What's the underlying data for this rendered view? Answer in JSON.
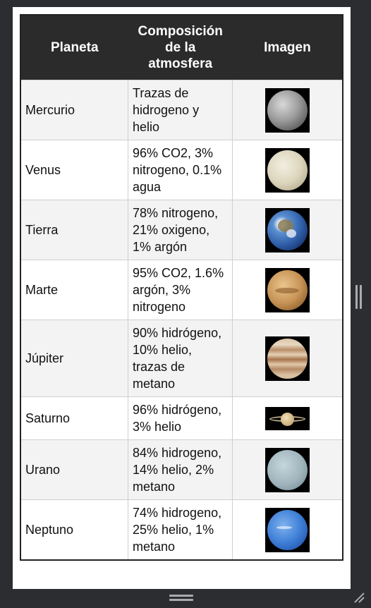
{
  "table": {
    "headers": {
      "planet": "Planeta",
      "composition": "Composición de la atmosfera",
      "image": "Imagen"
    },
    "rows": [
      {
        "name": "Mercurio",
        "atmosphere": "Trazas de hidrogeno y helio",
        "image_icon": "mercury-image"
      },
      {
        "name": "Venus",
        "atmosphere": "96% CO2, 3% nitrogeno, 0.1% agua",
        "image_icon": "venus-image"
      },
      {
        "name": "Tierra",
        "atmosphere": "78% nitrogeno, 21% oxigeno, 1% argón",
        "image_icon": "earth-image"
      },
      {
        "name": "Marte",
        "atmosphere": "95% CO2, 1.6% argón, 3% nitrogeno",
        "image_icon": "mars-image"
      },
      {
        "name": "Júpiter",
        "atmosphere": "90% hidrógeno, 10% helio, trazas de metano",
        "image_icon": "jupiter-image"
      },
      {
        "name": "Saturno",
        "atmosphere": "96% hidrógeno, 3% helio",
        "image_icon": "saturn-image"
      },
      {
        "name": "Urano",
        "atmosphere": "84% hidrogeno, 14% helio, 2% metano",
        "image_icon": "uranus-image"
      },
      {
        "name": "Neptuno",
        "atmosphere": "74% hidrogeno, 25% helio, 1% metano",
        "image_icon": "neptune-image"
      }
    ]
  },
  "colors": {
    "header_bg": "#2b2b2b",
    "header_text": "#ffffff",
    "row_alt_bg": "#f3f3f3",
    "window_bg": "#2b2d31"
  }
}
